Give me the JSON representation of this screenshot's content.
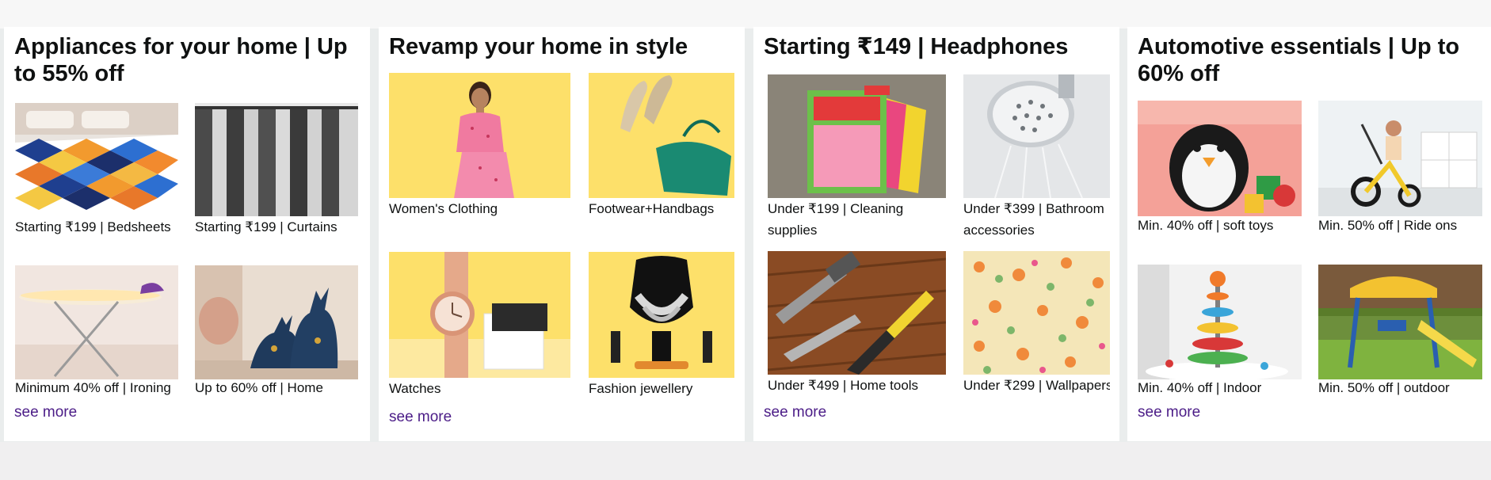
{
  "cards": [
    {
      "title": "Appliances for your home | Up to 55% off",
      "tiles": [
        {
          "caption": "Starting ₹199 | Bedsheets"
        },
        {
          "caption": "Starting ₹199 | Curtains"
        },
        {
          "caption": "Minimum 40% off | Ironing"
        },
        {
          "caption": "Up to 60% off | Home"
        }
      ],
      "see_more": "see more"
    },
    {
      "title": "Revamp your home in style",
      "tiles": [
        {
          "caption": "Women's Clothing"
        },
        {
          "caption": "Footwear+Handbags"
        },
        {
          "caption": "Watches"
        },
        {
          "caption": "Fashion jewellery"
        }
      ],
      "see_more": "see more"
    },
    {
      "title": "Starting ₹149 | Headphones",
      "tiles": [
        {
          "caption": "Under ₹199 | Cleaning supplies"
        },
        {
          "caption": "Under ₹399 | Bathroom accessories"
        },
        {
          "caption": "Under ₹499 | Home tools"
        },
        {
          "caption": "Under ₹299 | Wallpapers"
        }
      ],
      "see_more": "see more"
    },
    {
      "title": "Automotive essentials | Up to 60% off",
      "tiles": [
        {
          "caption": "Min. 40% off | soft toys"
        },
        {
          "caption": "Min. 50% off | Ride ons"
        },
        {
          "caption": "Min. 40% off | Indoor"
        },
        {
          "caption": "Min. 50% off | outdoor"
        }
      ],
      "see_more": "see more"
    }
  ]
}
